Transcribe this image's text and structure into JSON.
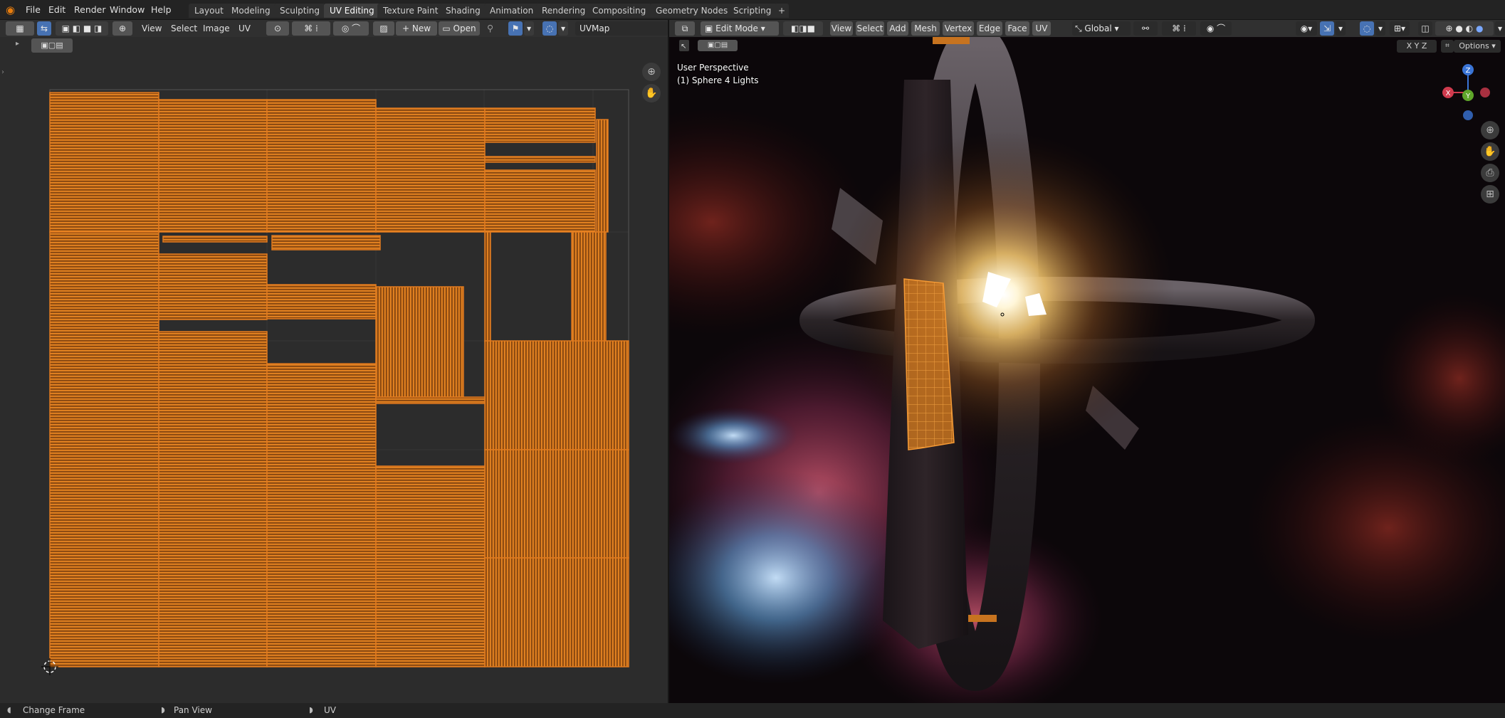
{
  "topbar": {
    "menus": [
      "File",
      "Edit",
      "Render",
      "Window",
      "Help"
    ],
    "workspaces": [
      "Layout",
      "Modeling",
      "Sculpting",
      "UV Editing",
      "Texture Paint",
      "Shading",
      "Animation",
      "Rendering",
      "Compositing",
      "Geometry Nodes",
      "Scripting"
    ],
    "active_workspace": "UV Editing",
    "add_tab": "+"
  },
  "uv_header": {
    "menus": [
      "View",
      "Select",
      "Image",
      "UV"
    ],
    "new_label": "New",
    "open_label": "Open",
    "uvmap": "UVMap"
  },
  "view_header": {
    "mode": "Edit Mode",
    "menus": [
      "View",
      "Select",
      "Add",
      "Mesh",
      "Vertex",
      "Edge",
      "Face",
      "UV"
    ],
    "orientation": "Global",
    "axes": [
      "X",
      "Y",
      "Z"
    ],
    "options": "Options"
  },
  "viewport": {
    "perspective": "User Perspective",
    "object": "(1) Sphere 4 Lights",
    "gizmo": {
      "z": "Z",
      "y": "Y",
      "x": "X"
    }
  },
  "statusbar": {
    "items": [
      "Change Frame",
      "Pan View",
      "UV"
    ]
  },
  "colors": {
    "accent": "#4772b3",
    "uv_edges": "#e07a1f",
    "uv_fill": "#b9661d"
  }
}
